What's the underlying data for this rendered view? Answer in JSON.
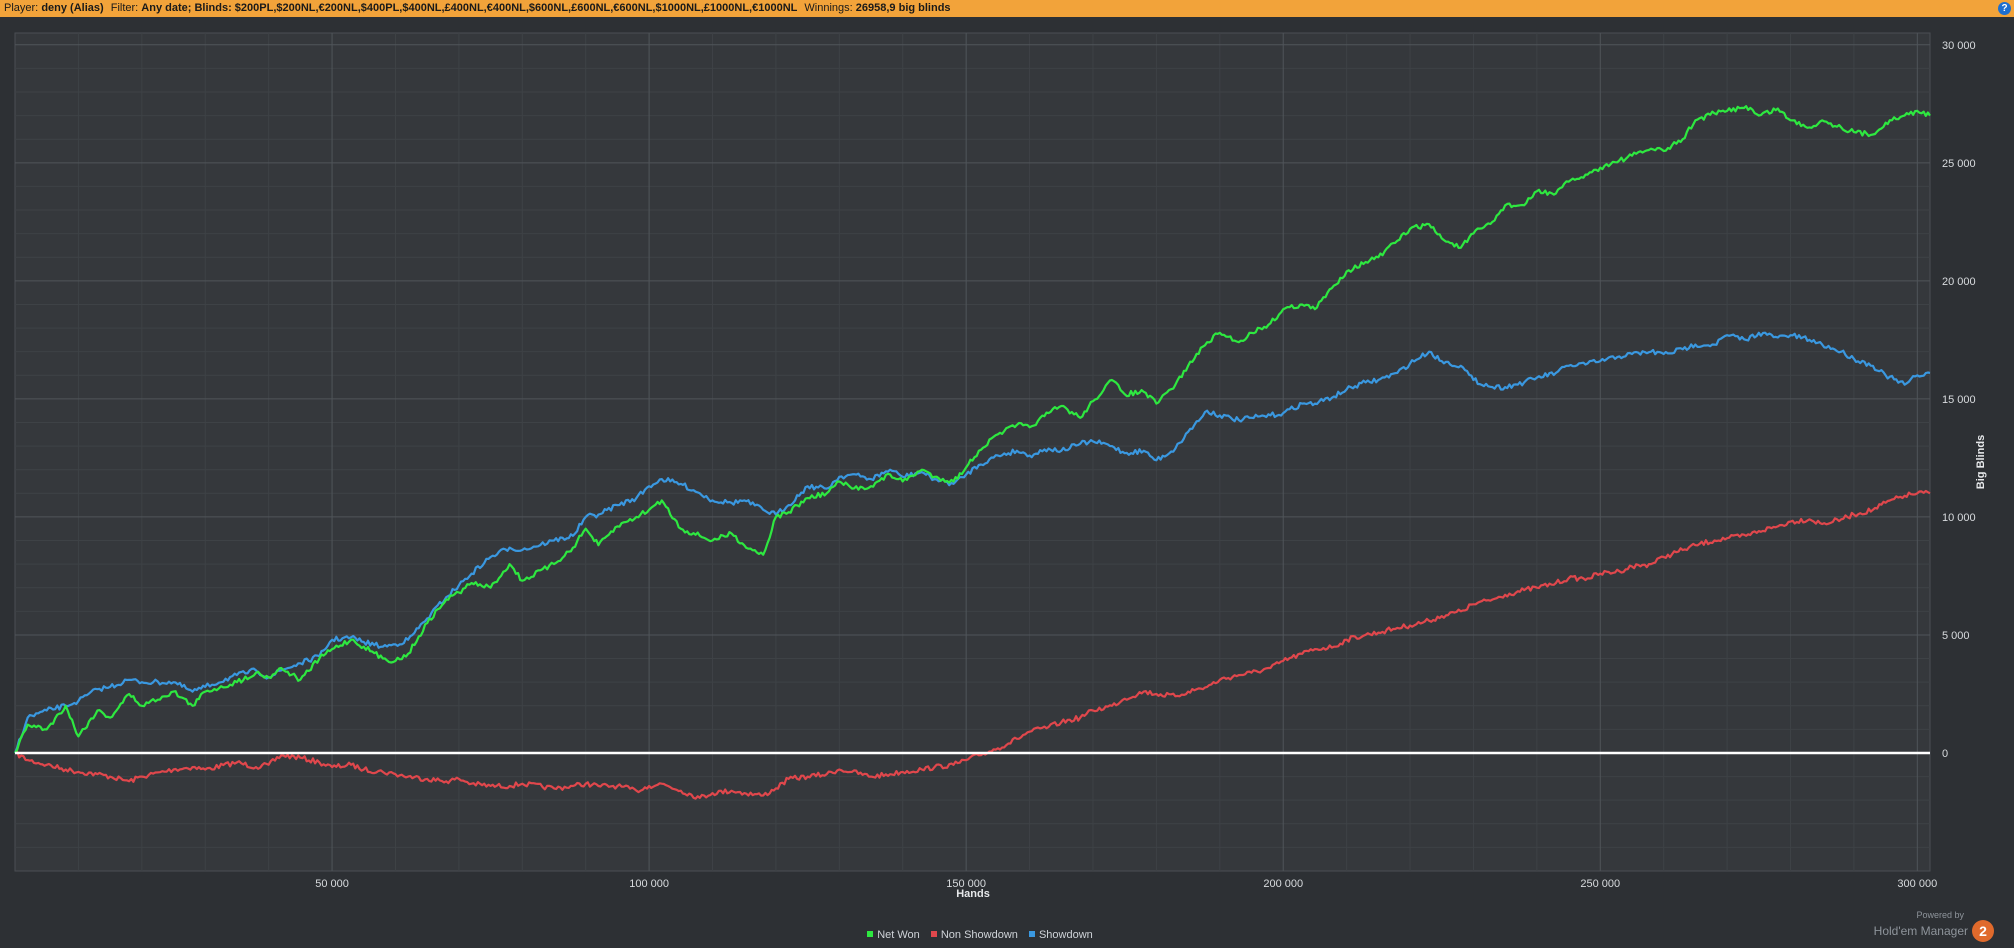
{
  "header": {
    "player_label": "Player:",
    "player_value": "deny (Alias)",
    "filter_label": "Filter:",
    "filter_value": "Any date; Blinds: $200PL,$200NL,€200NL,$400PL,$400NL,£400NL,€400NL,$600NL,£600NL,€600NL,$1000NL,£1000NL,€1000NL",
    "winnings_label": "Winnings:",
    "winnings_value": "26958,9 big blinds",
    "help_glyph": "?"
  },
  "branding": {
    "powered_by": "Powered by",
    "name": "Hold'em Manager",
    "logo_text": "2"
  },
  "colors": {
    "background": "#2d3034",
    "plot_background": "#35383c",
    "net_won": "#2ee840",
    "non_showdown": "#e0474c",
    "showdown": "#3a98e0",
    "zero_line": "#ffffff",
    "header_bar": "#f2a33a"
  },
  "chart_data": {
    "type": "line",
    "xlabel": "Hands",
    "ylabel": "Big Blinds",
    "xlim": [
      0,
      302000
    ],
    "ylim": [
      -5000,
      30500
    ],
    "x_ticks": [
      50000,
      100000,
      150000,
      200000,
      250000,
      300000
    ],
    "x_tick_labels": [
      "50 000",
      "100 000",
      "150 000",
      "200 000",
      "250 000",
      "300 000"
    ],
    "y_ticks": [
      0,
      5000,
      10000,
      15000,
      20000,
      25000,
      30000
    ],
    "y_tick_labels": [
      "0",
      "5 000",
      "10 000",
      "15 000",
      "20 000",
      "25 000",
      "30 000"
    ],
    "y_axis_side": "right",
    "grid": true,
    "legend_position": "bottom-center",
    "x": [
      0,
      2000,
      5000,
      8000,
      10000,
      13000,
      15000,
      18000,
      20000,
      25000,
      28000,
      30000,
      35000,
      38000,
      40000,
      42000,
      45000,
      48000,
      50000,
      53000,
      55000,
      58000,
      60000,
      62000,
      65000,
      68000,
      70000,
      72000,
      75000,
      78000,
      80000,
      85000,
      88000,
      90000,
      92000,
      95000,
      98000,
      100000,
      102000,
      105000,
      108000,
      110000,
      113000,
      115000,
      118000,
      120000,
      122000,
      125000,
      128000,
      130000,
      132000,
      135000,
      138000,
      140000,
      143000,
      145000,
      148000,
      150000,
      152000,
      155000,
      158000,
      160000,
      163000,
      165000,
      168000,
      170000,
      173000,
      175000,
      178000,
      180000,
      183000,
      185000,
      188000,
      190000,
      193000,
      195000,
      198000,
      200000,
      203000,
      205000,
      208000,
      210000,
      213000,
      215000,
      218000,
      220000,
      223000,
      225000,
      228000,
      230000,
      233000,
      235000,
      238000,
      240000,
      243000,
      245000,
      248000,
      250000,
      253000,
      255000,
      258000,
      260000,
      263000,
      265000,
      268000,
      270000,
      273000,
      275000,
      278000,
      280000,
      283000,
      285000,
      288000,
      290000,
      293000,
      295000,
      298000,
      300000,
      302000
    ],
    "series": [
      {
        "name": "Net Won",
        "values": [
          0,
          1200,
          1000,
          2000,
          700,
          1800,
          1500,
          2500,
          2000,
          2600,
          2000,
          2600,
          3000,
          3400,
          3200,
          3600,
          3100,
          4000,
          4400,
          4800,
          4500,
          4000,
          3900,
          4200,
          5500,
          6500,
          6800,
          7200,
          7000,
          8000,
          7300,
          8000,
          8700,
          9500,
          8800,
          9600,
          10000,
          10300,
          10700,
          9500,
          9200,
          9000,
          9300,
          8800,
          8400,
          10000,
          10200,
          10800,
          11000,
          11500,
          11200,
          11300,
          11800,
          11500,
          12000,
          11700,
          11500,
          12100,
          12800,
          13500,
          13900,
          13800,
          14400,
          14700,
          14200,
          14900,
          15800,
          15200,
          15300,
          14800,
          15600,
          16400,
          17400,
          17800,
          17400,
          17800,
          18200,
          18800,
          19000,
          18800,
          19800,
          20400,
          20800,
          21000,
          21700,
          22200,
          22400,
          21800,
          21400,
          22000,
          22500,
          23200,
          23200,
          23800,
          23700,
          24200,
          24500,
          24800,
          25100,
          25300,
          25600,
          25500,
          26000,
          26800,
          27100,
          27200,
          27400,
          27000,
          27300,
          26800,
          26500,
          26800,
          26500,
          26300,
          26200,
          26700,
          27000,
          27200,
          27000
        ]
      },
      {
        "name": "Non Showdown",
        "values": [
          0,
          -300,
          -500,
          -700,
          -800,
          -900,
          -1000,
          -1200,
          -1000,
          -700,
          -600,
          -700,
          -400,
          -600,
          -500,
          -100,
          -200,
          -400,
          -600,
          -500,
          -700,
          -800,
          -900,
          -1000,
          -1100,
          -1200,
          -1100,
          -1300,
          -1400,
          -1400,
          -1300,
          -1500,
          -1400,
          -1300,
          -1400,
          -1400,
          -1600,
          -1400,
          -1300,
          -1600,
          -1900,
          -1700,
          -1600,
          -1700,
          -1800,
          -1500,
          -1100,
          -1000,
          -900,
          -700,
          -800,
          -1000,
          -900,
          -800,
          -700,
          -600,
          -500,
          -300,
          -100,
          200,
          600,
          900,
          1100,
          1300,
          1500,
          1800,
          2000,
          2300,
          2600,
          2500,
          2400,
          2600,
          2800,
          3100,
          3300,
          3400,
          3600,
          3900,
          4200,
          4400,
          4500,
          4800,
          5000,
          5100,
          5300,
          5400,
          5600,
          5800,
          6000,
          6300,
          6500,
          6700,
          6900,
          7000,
          7200,
          7400,
          7400,
          7600,
          7700,
          7900,
          8000,
          8300,
          8600,
          8800,
          9000,
          9100,
          9200,
          9400,
          9600,
          9800,
          9900,
          9700,
          9900,
          10100,
          10300,
          10600,
          10900,
          11000,
          11000
        ]
      },
      {
        "name": "Showdown",
        "values": [
          0,
          1500,
          1800,
          2000,
          2200,
          2700,
          2800,
          3100,
          3000,
          3000,
          2600,
          2800,
          3300,
          3500,
          3200,
          3500,
          3800,
          4100,
          4800,
          4900,
          4700,
          4500,
          4600,
          4800,
          5700,
          6600,
          7100,
          7600,
          8300,
          8700,
          8600,
          9000,
          9200,
          10000,
          10100,
          10500,
          10800,
          11300,
          11600,
          11400,
          11000,
          10700,
          10600,
          10700,
          10300,
          10100,
          10500,
          11300,
          11200,
          11700,
          11800,
          11600,
          12000,
          11700,
          11900,
          11600,
          11400,
          11800,
          12200,
          12600,
          12800,
          12600,
          12900,
          12800,
          13100,
          13200,
          13000,
          12700,
          12800,
          12400,
          12900,
          13600,
          14500,
          14300,
          14100,
          14200,
          14300,
          14400,
          14800,
          14800,
          15100,
          15400,
          15700,
          15800,
          16100,
          16500,
          17000,
          16600,
          16400,
          15800,
          15500,
          15500,
          15700,
          15900,
          16100,
          16400,
          16500,
          16600,
          16800,
          16900,
          17000,
          16900,
          17100,
          17300,
          17300,
          17700,
          17500,
          17800,
          17600,
          17700,
          17500,
          17300,
          17000,
          16700,
          16400,
          16000,
          15600,
          16000,
          16100
        ]
      }
    ]
  }
}
